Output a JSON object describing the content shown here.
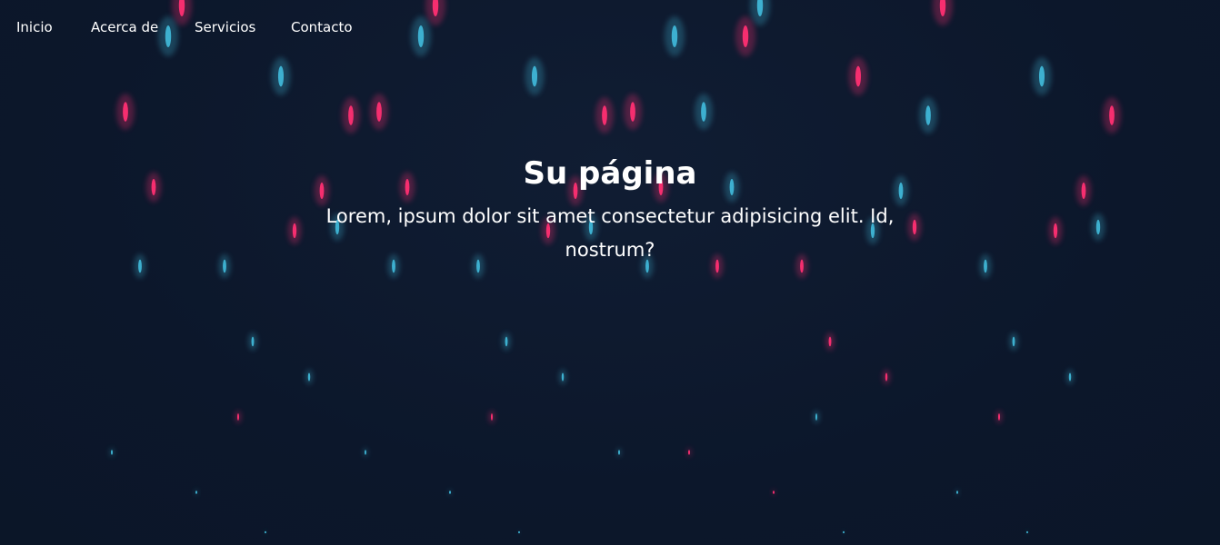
{
  "nav": {
    "items": [
      {
        "label": "Inicio"
      },
      {
        "label": "Acerca de"
      },
      {
        "label": "Servicios"
      },
      {
        "label": "Contacto"
      }
    ]
  },
  "hero": {
    "title": "Su página",
    "description": "Lorem, ipsum dolor sit amet consectetur adipisicing elit. Id, nostrum?"
  },
  "colors": {
    "background": "#0c172b",
    "drop_blue": "#3fb6d6",
    "drop_pink": "#ff2f72",
    "text": "#ffffff"
  }
}
